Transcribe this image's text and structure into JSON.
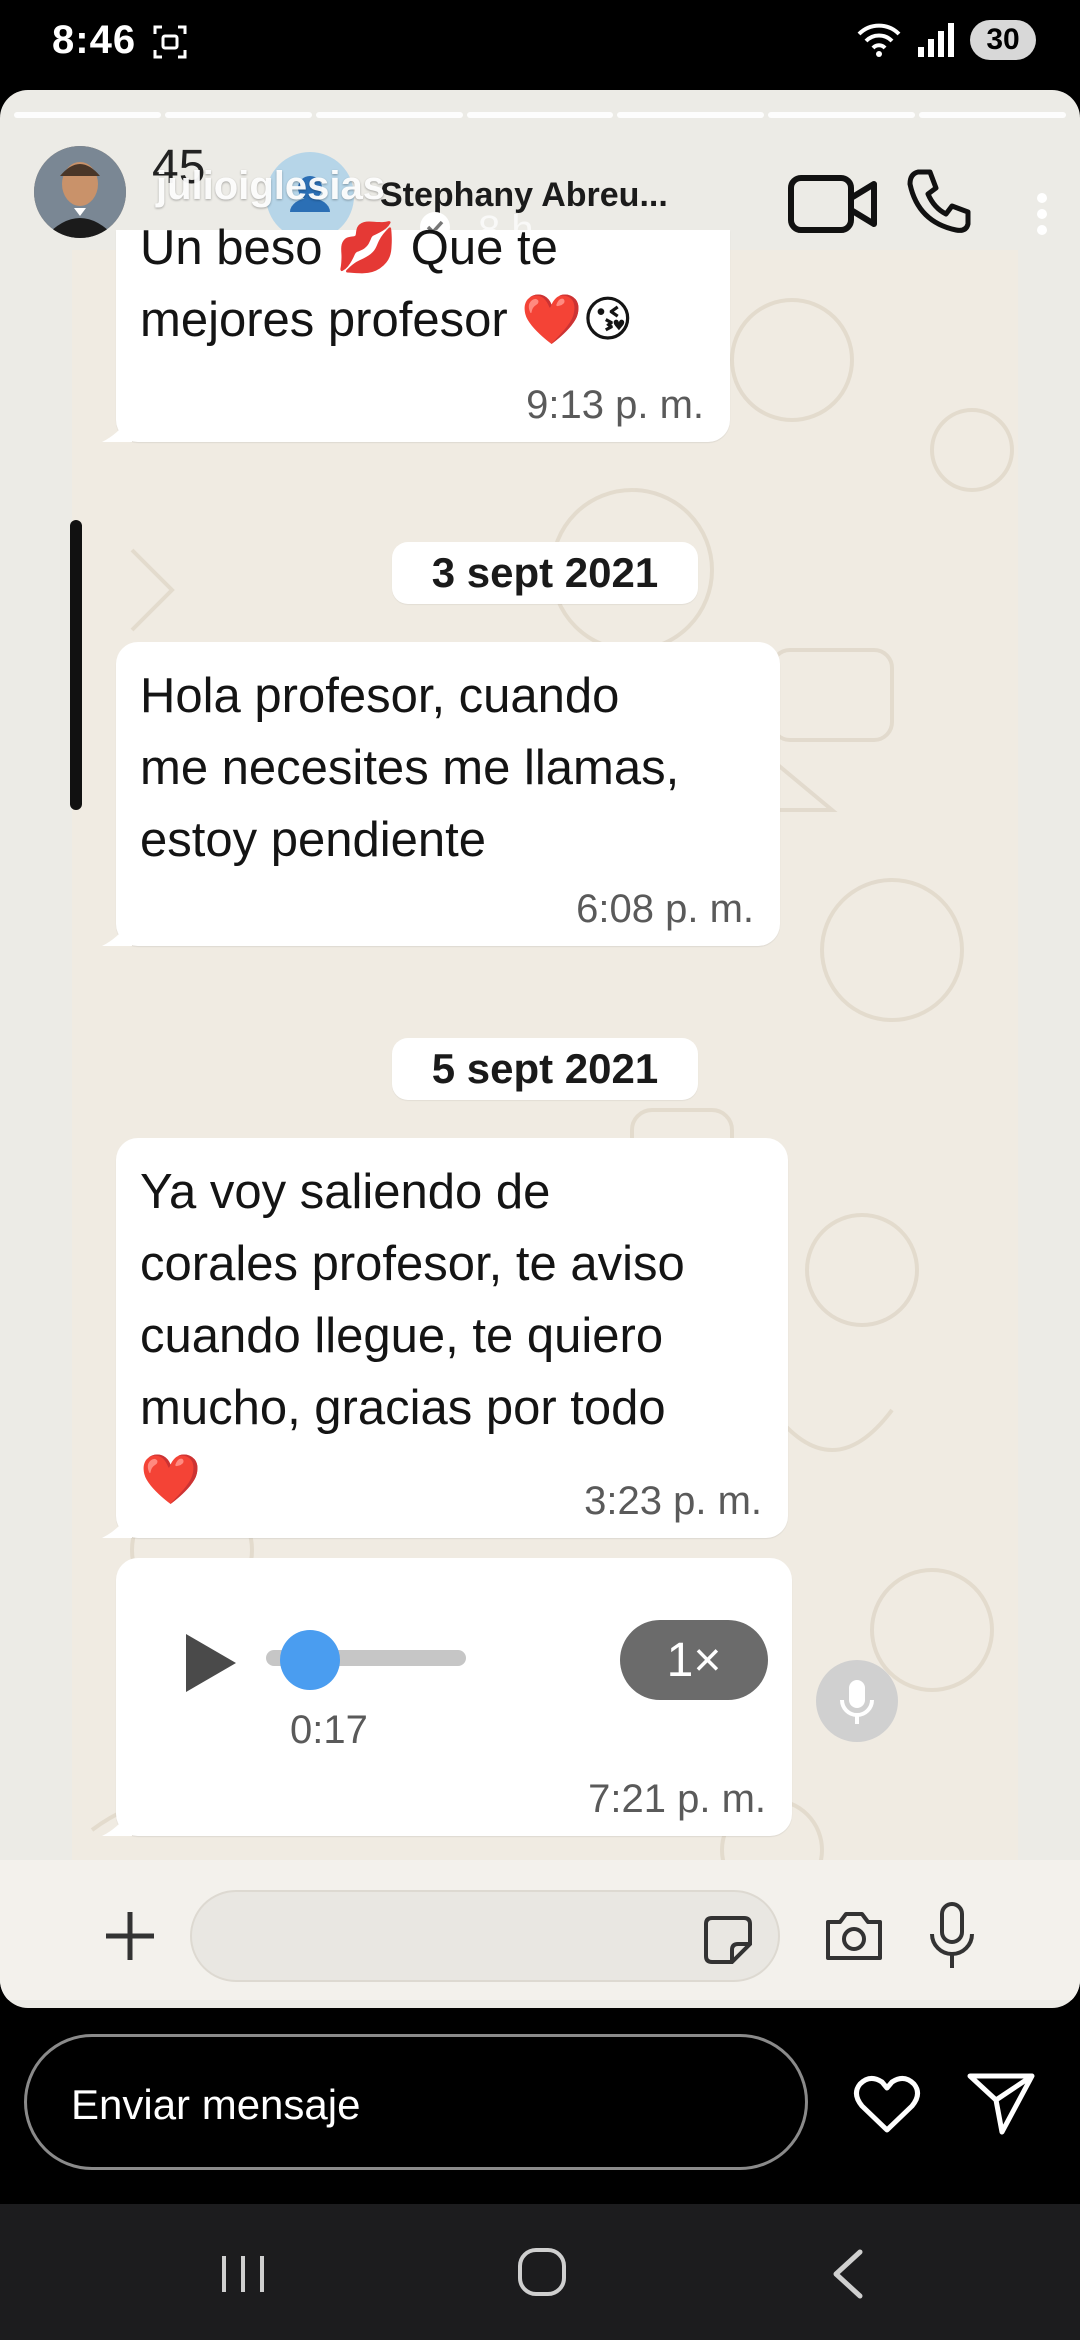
{
  "status_bar": {
    "time": "8:46",
    "battery": "30"
  },
  "story": {
    "username": "julioiglesias",
    "time_ago": "8 h",
    "segments": 7
  },
  "whatsapp": {
    "back_count": "45",
    "contact_name": "Stephany Abreu...",
    "messages": [
      {
        "text": "Un beso 💋 Que te\nmejores profesor ❤️😘",
        "time": "9:13 p. m."
      },
      {
        "text": "Hola profesor, cuando\nme necesites me llamas,\nestoy pendiente",
        "time": "6:08 p. m."
      },
      {
        "text": "Ya voy saliendo de\ncorales profesor, te aviso\ncuando llegue, te quiero\nmucho, gracias por todo\n❤️",
        "time": "3:23 p. m."
      }
    ],
    "dates": [
      "3 sept 2021",
      "5 sept 2021"
    ],
    "audio": {
      "duration": "0:17",
      "speed": "1×",
      "time": "7:21 p. m.",
      "progress": 0.0
    }
  },
  "reply": {
    "placeholder": "Enviar mensaje"
  }
}
